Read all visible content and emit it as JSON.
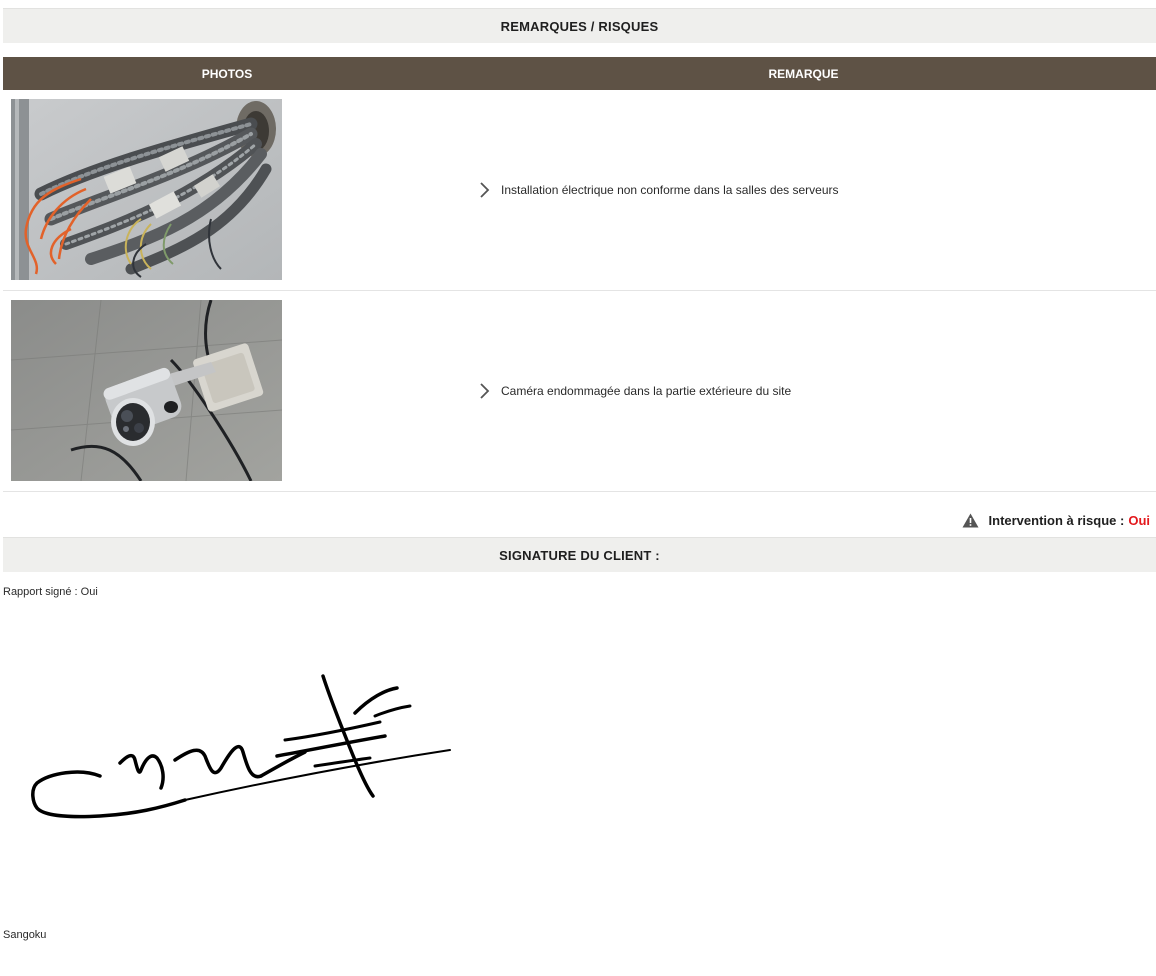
{
  "remarks_section": {
    "title": "REMARQUES / RISQUES",
    "columns": {
      "photos": "PHOTOS",
      "remark": "REMARQUE"
    },
    "rows": [
      {
        "photo_icon": "electrical-wiring-photo",
        "text": "Installation électrique non conforme dans la salles des serveurs"
      },
      {
        "photo_icon": "damaged-camera-photo",
        "text": "Caméra endommagée dans la partie extérieure du site"
      }
    ]
  },
  "risk": {
    "label": "Intervention à risque :",
    "value": "Oui",
    "value_color": "#e3181c",
    "icon": "warning-icon"
  },
  "signature_section": {
    "title": "SIGNATURE DU CLIENT :",
    "signed_status": "Rapport signé : Oui",
    "signature_icon": "handwritten-signature",
    "signer_name": "Sangoku"
  },
  "colors": {
    "header_bg": "#efefed",
    "table_head_bg": "#5e5245"
  }
}
